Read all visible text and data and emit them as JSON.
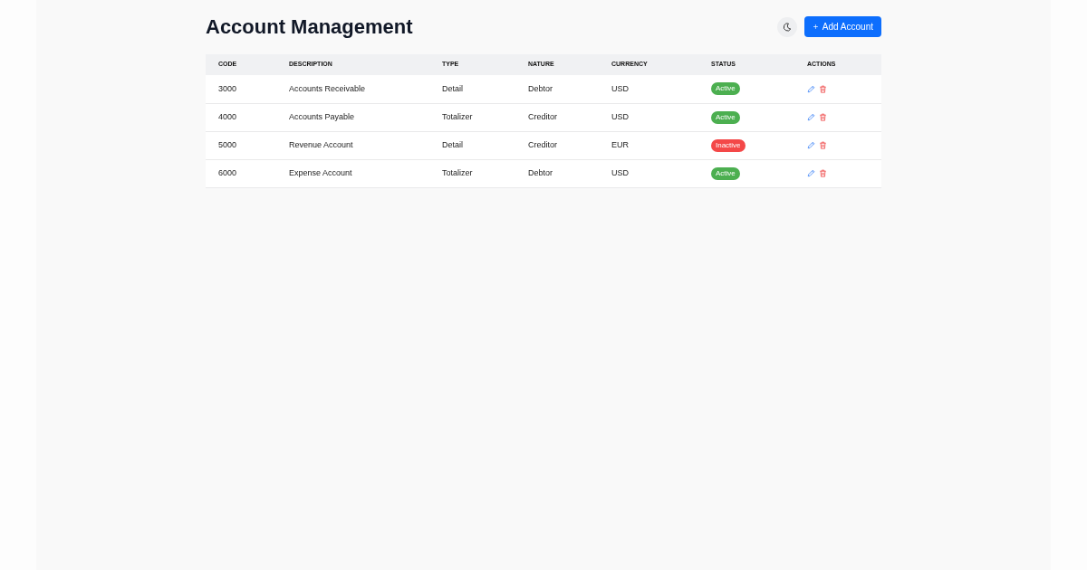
{
  "page": {
    "title": "Account Management"
  },
  "toolbar": {
    "add_button": "Add Account"
  },
  "table": {
    "columns": [
      "CODE",
      "DESCRIPTION",
      "TYPE",
      "NATURE",
      "CURRENCY",
      "STATUS",
      "ACTIONS"
    ],
    "rows": [
      {
        "code": "3000",
        "description": "Accounts Receivable",
        "type": "Detail",
        "nature": "Debtor",
        "currency": "USD",
        "status": {
          "label": "Active",
          "color": "#4caf50"
        }
      },
      {
        "code": "4000",
        "description": "Accounts Payable",
        "type": "Totalizer",
        "nature": "Creditor",
        "currency": "USD",
        "status": {
          "label": "Active",
          "color": "#4caf50"
        }
      },
      {
        "code": "5000",
        "description": "Revenue Account",
        "type": "Detail",
        "nature": "Creditor",
        "currency": "EUR",
        "status": {
          "label": "Inactive",
          "color": "#f44848"
        }
      },
      {
        "code": "6000",
        "description": "Expense Account",
        "type": "Totalizer",
        "nature": "Debtor",
        "currency": "USD",
        "status": {
          "label": "Active",
          "color": "#4caf50"
        }
      }
    ]
  }
}
